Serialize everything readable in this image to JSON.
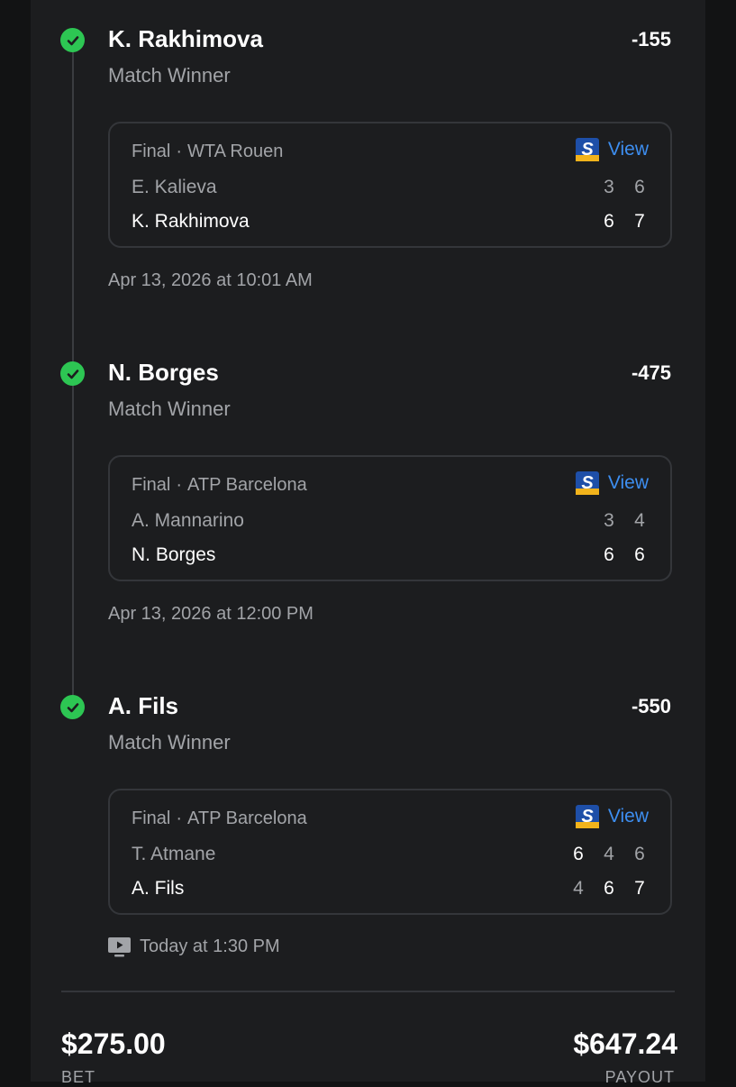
{
  "legs": [
    {
      "player": "K. Rakhimova",
      "odds": "-155",
      "market": "Match Winner",
      "status": "Final",
      "separator": "·",
      "tournament": "WTA Rouen",
      "view_label": "View",
      "players": [
        {
          "name": "E. Kalieva",
          "scores": [
            "3",
            "6"
          ]
        },
        {
          "name": "K. Rakhimova",
          "scores": [
            "6",
            "7"
          ]
        }
      ],
      "date": "Apr 13, 2026 at 10:01 AM"
    },
    {
      "player": "N. Borges",
      "odds": "-475",
      "market": "Match Winner",
      "status": "Final",
      "separator": "·",
      "tournament": "ATP Barcelona",
      "view_label": "View",
      "players": [
        {
          "name": "A. Mannarino",
          "scores": [
            "3",
            "4"
          ]
        },
        {
          "name": "N. Borges",
          "scores": [
            "6",
            "6"
          ]
        }
      ],
      "date": "Apr 13, 2026 at 12:00 PM"
    },
    {
      "player": "A. Fils",
      "odds": "-550",
      "market": "Match Winner",
      "status": "Final",
      "separator": "·",
      "tournament": "ATP Barcelona",
      "view_label": "View",
      "players": [
        {
          "name": "T. Atmane",
          "scores": [
            "6",
            "4",
            "6"
          ]
        },
        {
          "name": "A. Fils",
          "scores": [
            "4",
            "6",
            "7"
          ]
        }
      ],
      "date": "Today at 1:30 PM"
    }
  ],
  "summary": {
    "bet_amount": "$275.00",
    "bet_label": "BET",
    "payout_amount": "$647.24",
    "payout_label": "PAYOUT"
  },
  "icons": {
    "leg_status": "check-circle-icon",
    "provider_logo": "s-logo-icon",
    "stream": "tv-play-icon"
  },
  "colors": {
    "background": "#121314",
    "card": "#1c1d1f",
    "success": "#2dc653",
    "link": "#3d8ef0",
    "muted_text": "#a2a4a8",
    "border": "#34363a"
  }
}
